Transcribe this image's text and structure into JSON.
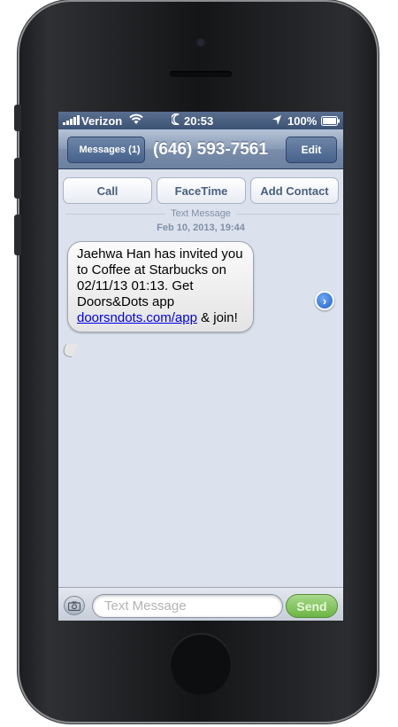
{
  "statusbar": {
    "carrier": "Verizon",
    "wifi_icon": "wifi-icon",
    "moon_icon": "moon-icon",
    "time": "20:53",
    "location_icon": "location-arrow-icon",
    "battery": "100%",
    "battery_icon": "battery-icon"
  },
  "navbar": {
    "back_label": "Messages (1)",
    "title": "(646) 593-7561",
    "edit_label": "Edit"
  },
  "actions": {
    "call": "Call",
    "facetime": "FaceTime",
    "add_contact": "Add Contact"
  },
  "thread": {
    "type_label": "Text Message",
    "date": "Feb 10, 2013, 19:44",
    "message_text": "Jaehwa Han has invited you to Coffee at Starbucks on 02/11/13 01:13. Get Doors&Dots app ",
    "message_link": "doorsndots.com/app",
    "message_suffix": " & join!"
  },
  "compose": {
    "camera_icon": "camera-icon",
    "placeholder": "Text Message",
    "send_label": "Send"
  },
  "colors": {
    "nav_blue": "#6c81a0",
    "screen_bg": "#dbe2ed",
    "send_green": "#6cb544",
    "link_blue": "#0000ee"
  }
}
